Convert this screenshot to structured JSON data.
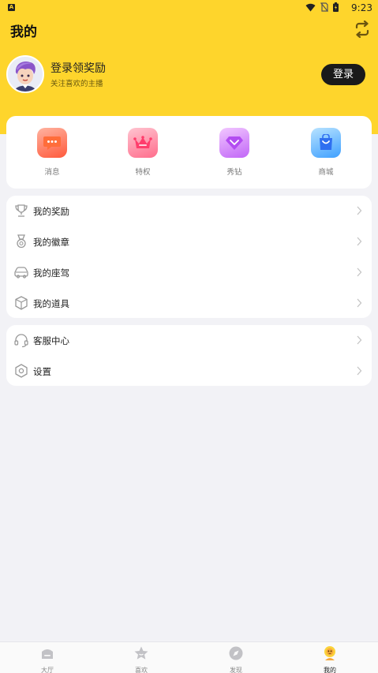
{
  "status_bar": {
    "time": "9:23",
    "badge": "A"
  },
  "header": {
    "title": "我的"
  },
  "profile": {
    "title": "登录领奖励",
    "subtitle": "关注喜欢的主播",
    "login_button": "登录"
  },
  "quick_actions": [
    {
      "label": "消息",
      "icon": "message-icon"
    },
    {
      "label": "特权",
      "icon": "crown-icon"
    },
    {
      "label": "秀钻",
      "icon": "diamond-icon"
    },
    {
      "label": "商城",
      "icon": "shopping-bag-icon"
    }
  ],
  "menu_group_1": [
    {
      "label": "我的奖励",
      "icon": "trophy-icon"
    },
    {
      "label": "我的徽章",
      "icon": "medal-icon"
    },
    {
      "label": "我的座驾",
      "icon": "car-icon"
    },
    {
      "label": "我的道具",
      "icon": "box-icon"
    }
  ],
  "menu_group_2": [
    {
      "label": "客服中心",
      "icon": "headset-icon"
    },
    {
      "label": "设置",
      "icon": "settings-icon"
    }
  ],
  "tabs": [
    {
      "label": "大厅",
      "icon": "hall-icon",
      "active": false
    },
    {
      "label": "喜欢",
      "icon": "star-icon",
      "active": false
    },
    {
      "label": "发现",
      "icon": "compass-icon",
      "active": false
    },
    {
      "label": "我的",
      "icon": "me-icon",
      "active": true
    }
  ],
  "colors": {
    "brand_yellow": "#fed52c",
    "background": "#f2f2f6",
    "button_dark": "#1a1a1a"
  }
}
